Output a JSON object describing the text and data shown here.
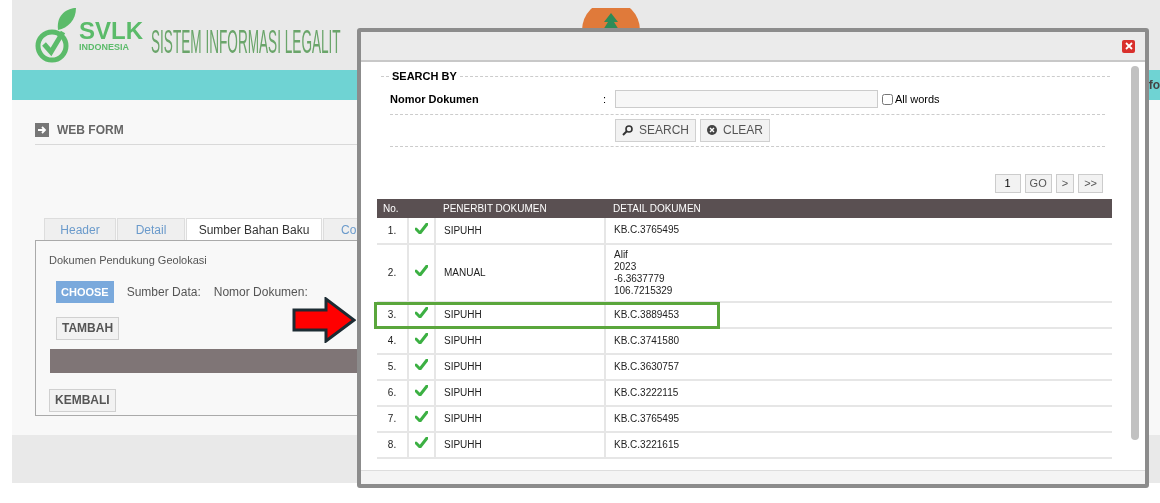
{
  "header": {
    "logo_text": "SVLK",
    "logo_subtext": "INDONESIA",
    "title": "SISTEM INFORMASI LEGALIT",
    "nav_text": "fo"
  },
  "page": {
    "section_title": "WEB FORM",
    "tabs": [
      {
        "label": "Header",
        "selected": false
      },
      {
        "label": "Detail",
        "selected": false
      },
      {
        "label": "Sumber Bahan Baku",
        "selected": true
      },
      {
        "label": "Co",
        "selected": false
      }
    ],
    "panel_title": "Dokumen Pendukung Geolokasi",
    "choose_button": "CHOOSE",
    "source_label": "Sumber Data:",
    "number_label": "Nomor Dokumen:",
    "add_button": "TAMBAH",
    "back_button": "KEMBALI"
  },
  "modal": {
    "search": {
      "legend": "SEARCH BY",
      "field_label": "Nomor Dokumen",
      "colon": ":",
      "all_words": {
        "label": "All words",
        "checked": false
      },
      "search_button": "SEARCH",
      "clear_button": "CLEAR"
    },
    "pager": {
      "page": "1",
      "go_button": "GO",
      "next_button": ">",
      "last_button": ">>"
    },
    "table": {
      "columns": [
        "No.",
        "PENERBIT DOKUMEN",
        "DETAIL DOKUMEN"
      ],
      "rows": [
        {
          "no": "1.",
          "valid": true,
          "issuer": "SIPUHH",
          "detail": [
            "KB.C.3765495"
          ],
          "highlighted": false
        },
        {
          "no": "2.",
          "valid": true,
          "issuer": "MANUAL",
          "detail": [
            "Alif",
            "2023",
            "-6.3637779",
            "106.7215329"
          ],
          "highlighted": false
        },
        {
          "no": "3.",
          "valid": true,
          "issuer": "SIPUHH",
          "detail": [
            "KB.C.3889453"
          ],
          "highlighted": true
        },
        {
          "no": "4.",
          "valid": true,
          "issuer": "SIPUHH",
          "detail": [
            "KB.C.3741580"
          ],
          "highlighted": false
        },
        {
          "no": "5.",
          "valid": true,
          "issuer": "SIPUHH",
          "detail": [
            "KB.C.3630757"
          ],
          "highlighted": false
        },
        {
          "no": "6.",
          "valid": true,
          "issuer": "SIPUHH",
          "detail": [
            "KB.C.3222115"
          ],
          "highlighted": false
        },
        {
          "no": "7.",
          "valid": true,
          "issuer": "SIPUHH",
          "detail": [
            "KB.C.3765495"
          ],
          "highlighted": false
        },
        {
          "no": "8.",
          "valid": true,
          "issuer": "SIPUHH",
          "detail": [
            "KB.C.3221615"
          ],
          "highlighted": false
        }
      ]
    }
  }
}
